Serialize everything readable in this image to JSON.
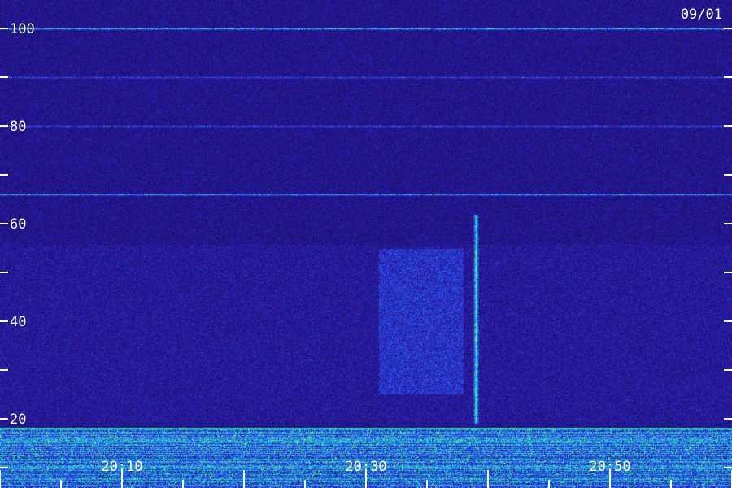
{
  "chart_data": {
    "type": "heatmap",
    "date_label": "09/01",
    "y_range": [
      0,
      100
    ],
    "y_tick_step": 10,
    "y_tick_labels": [
      "20",
      "40",
      "60",
      "80",
      "100"
    ],
    "x_tick_labels": [
      "20:10",
      "20:30",
      "20:50"
    ],
    "x_range": [
      "20:00",
      "21:00"
    ],
    "x_minor_tick_minutes": 5,
    "features": [
      {
        "kind": "horizontal-line",
        "y": 100,
        "level": 0.55
      },
      {
        "kind": "horizontal-line",
        "y": 90,
        "level": 0.25
      },
      {
        "kind": "horizontal-line",
        "y": 80,
        "level": 0.25
      },
      {
        "kind": "horizontal-line",
        "y": 66,
        "level": 0.45
      },
      {
        "kind": "vertical-streak",
        "x": "20:39",
        "y": [
          19,
          62
        ],
        "level": 0.6
      },
      {
        "kind": "diffuse-patch",
        "x": [
          "20:31",
          "20:38"
        ],
        "y": [
          25,
          55
        ],
        "level": 0.35
      },
      {
        "kind": "broadband-noise",
        "y": [
          0,
          18
        ],
        "level": 0.9
      }
    ],
    "colors": {
      "background": "#1a1070",
      "low": "#2a1aa0",
      "mid": "#2a5cff",
      "high": "#20c8d8",
      "peak": "#60ff60",
      "axis": "#ffffff"
    }
  }
}
